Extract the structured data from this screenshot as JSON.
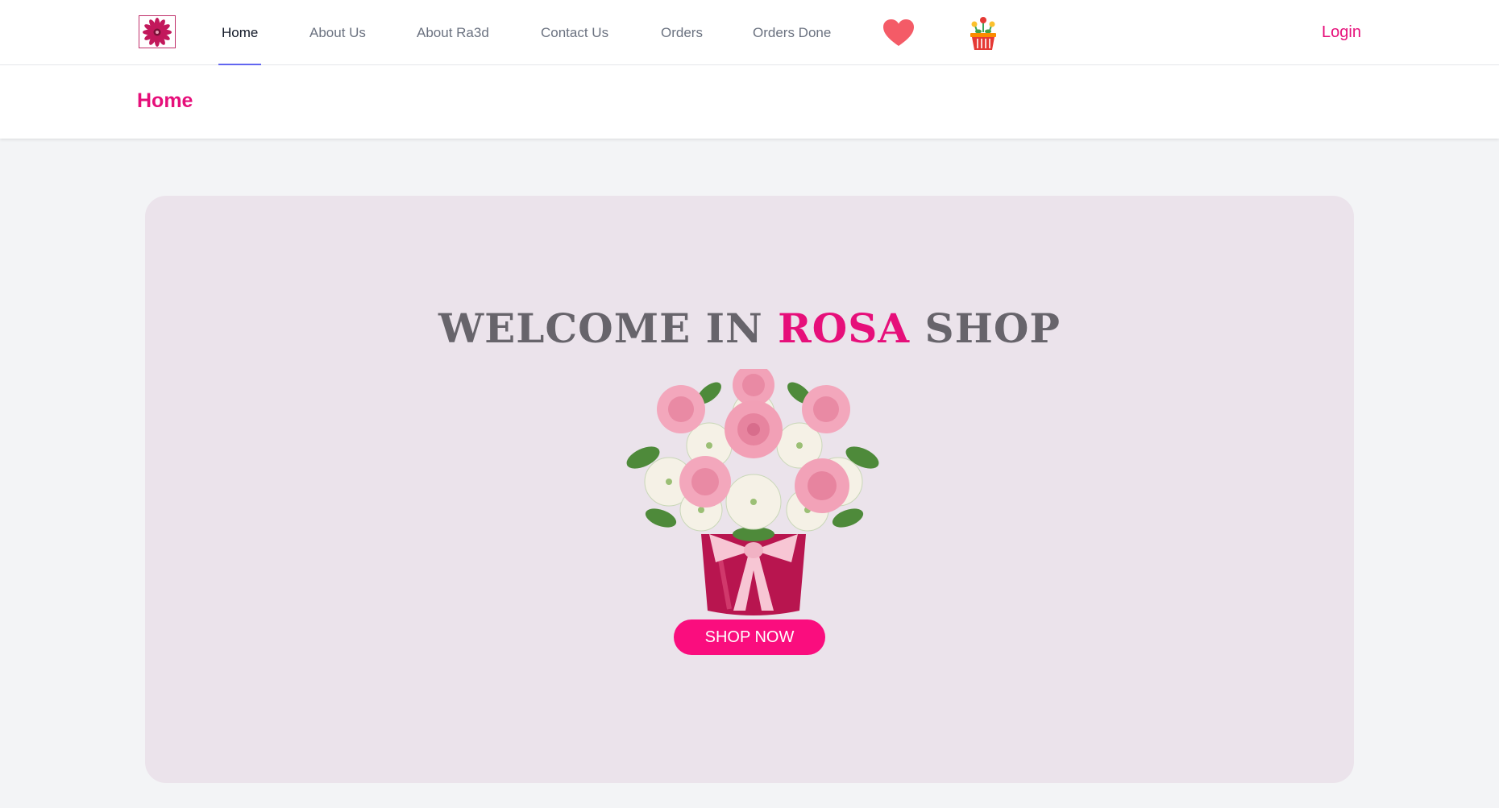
{
  "nav": {
    "logo_icon": "flower-logo-icon",
    "items": [
      {
        "label": "Home",
        "active": true
      },
      {
        "label": "About Us"
      },
      {
        "label": "About Ra3d"
      },
      {
        "label": "Contact Us"
      },
      {
        "label": "Orders"
      },
      {
        "label": "Orders Done"
      }
    ],
    "favorites_icon": "heart-icon",
    "cart_icon": "flower-basket-icon",
    "login_label": "Login"
  },
  "header": {
    "title": "Home"
  },
  "hero": {
    "title_prefix": "WELCOME IN ",
    "title_brand": "ROSA",
    "title_suffix": " SHOP",
    "image_icon": "rose-bouquet-image",
    "cta_label": "SHOP NOW"
  },
  "colors": {
    "accent": "#e60f7a",
    "cta": "#fa0d7e",
    "hero_bg": "#ebe3eb",
    "page_bg": "#f3f4f6",
    "active_underline": "#6366f1",
    "heart": "#f45b67"
  }
}
